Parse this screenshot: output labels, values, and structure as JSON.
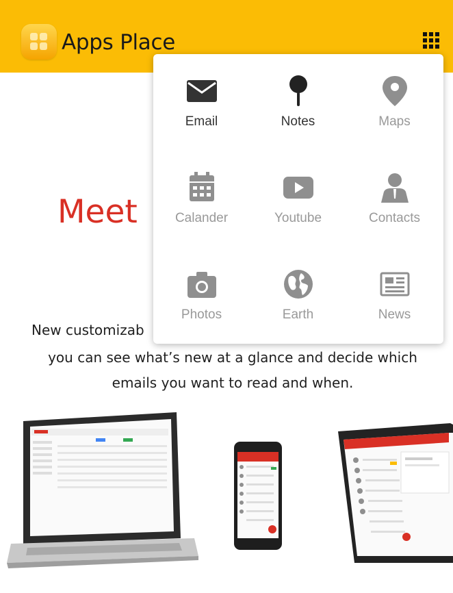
{
  "header": {
    "title": "Apps Place",
    "logo_icon": "folder-apps-icon",
    "menu_icon": "grid-menu-icon",
    "bg_color": "#fbbc05"
  },
  "hero": {
    "heading_visible": "Meet",
    "line1_visible": "New customizab",
    "line2": "you can see what’s new at a glance and decide which",
    "line3": "emails you want to read and when.",
    "heading_color": "#d93025"
  },
  "apps_menu": {
    "items": [
      {
        "label": "Email",
        "icon": "envelope-icon",
        "color": "#333333"
      },
      {
        "label": "Notes",
        "icon": "pushpin-icon",
        "color": "#333333"
      },
      {
        "label": "Maps",
        "icon": "map-marker-icon",
        "color": "#999999"
      },
      {
        "label": "Calander",
        "icon": "calendar-icon",
        "color": "#999999"
      },
      {
        "label": "Youtube",
        "icon": "youtube-icon",
        "color": "#999999"
      },
      {
        "label": "Contacts",
        "icon": "contact-person-icon",
        "color": "#999999"
      },
      {
        "label": "Photos",
        "icon": "camera-icon",
        "color": "#999999"
      },
      {
        "label": "Earth",
        "icon": "globe-icon",
        "color": "#999999"
      },
      {
        "label": "News",
        "icon": "newspaper-icon",
        "color": "#999999"
      }
    ]
  },
  "devices_image": {
    "description_icons": [
      "laptop-icon",
      "phone-icon",
      "tablet-icon"
    ]
  }
}
